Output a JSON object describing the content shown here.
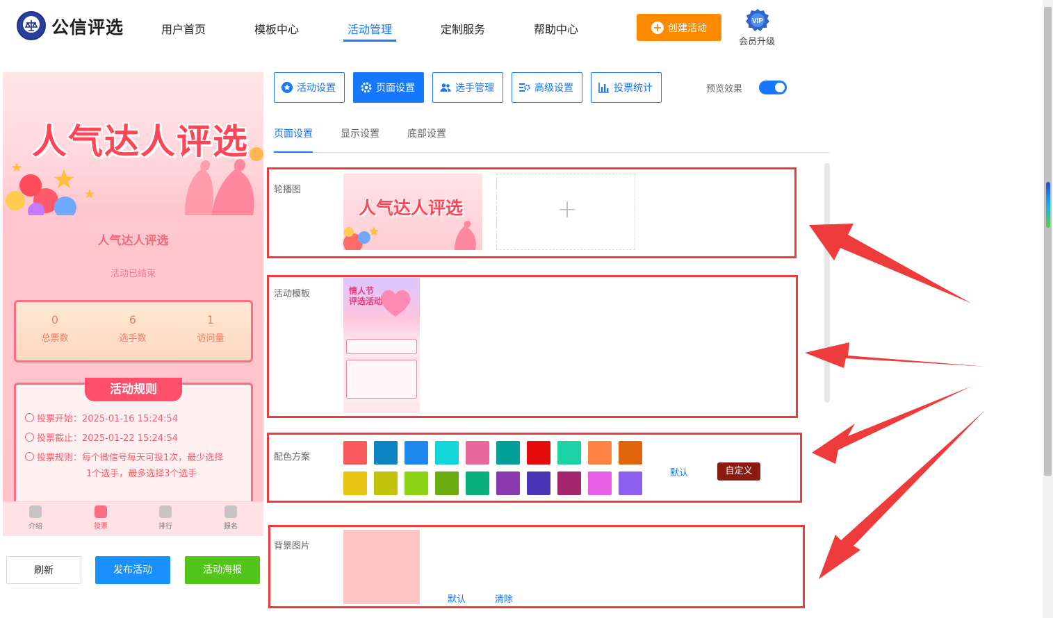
{
  "header": {
    "brand": "公信评选",
    "nav": [
      "用户首页",
      "模板中心",
      "活动管理",
      "定制服务",
      "帮助中心"
    ],
    "active_nav": "活动管理",
    "create_button": "创建活动",
    "vip_badge": "VIP",
    "vip_label": "会员升级"
  },
  "preview": {
    "banner_title": "人气达人评选",
    "activity_name": "人气达人评选",
    "status": "活动已结束",
    "stats": [
      {
        "value": "0",
        "label": "总票数"
      },
      {
        "value": "6",
        "label": "选手数"
      },
      {
        "value": "1",
        "label": "访问量"
      }
    ],
    "rules_title": "活动规则",
    "rules": {
      "start": "投票开始：2025-01-16 15:24:54",
      "end": "投票截止：2025-01-22 15:24:54",
      "rule_line1": "投票规则：每个微信号每天可投1次，最少选择",
      "rule_line2": "1个选手，最多选择3个选手"
    },
    "tabbar": [
      "介绍",
      "投票",
      "排行",
      "报名"
    ],
    "active_tab": "投票"
  },
  "actions": {
    "refresh": "刷新",
    "publish": "发布活动",
    "poster": "活动海报"
  },
  "toolbar": {
    "buttons": [
      "活动设置",
      "页面设置",
      "选手管理",
      "高级设置",
      "投票统计"
    ],
    "active": "页面设置",
    "preview_label": "预览效果",
    "preview_on": true
  },
  "subtabs": {
    "items": [
      "页面设置",
      "显示设置",
      "底部设置"
    ],
    "active": "页面设置"
  },
  "sections": {
    "carousel": {
      "label": "轮播图",
      "image_title": "人气达人评选",
      "add_symbol": "+"
    },
    "template": {
      "label": "活动模板",
      "thumb_title_1": "情人节",
      "thumb_title_2": "评选活动"
    },
    "colors": {
      "label": "配色方案",
      "row1": [
        "#f65a5a",
        "#0e84c4",
        "#1e88ee",
        "#12d6d8",
        "#e8689a",
        "#02a098",
        "#e40b0b",
        "#1cd3a5",
        "#ff8343",
        "#e0650c"
      ],
      "row2": [
        "#e8c512",
        "#c3c20b",
        "#8dd417",
        "#6aab10",
        "#08af7a",
        "#8a3aae",
        "#4a35b7",
        "#a3266e",
        "#e55ee3",
        "#8d5fee"
      ],
      "default_label": "默认",
      "custom_label": "自定义"
    },
    "background": {
      "label": "背景图片",
      "default_label": "默认",
      "clear_label": "清除",
      "color": "#ffc4c4"
    }
  },
  "colors": {
    "accent": "#1677ff",
    "orange": "#ff8a00",
    "annotation_red": "#ee3b3b"
  }
}
